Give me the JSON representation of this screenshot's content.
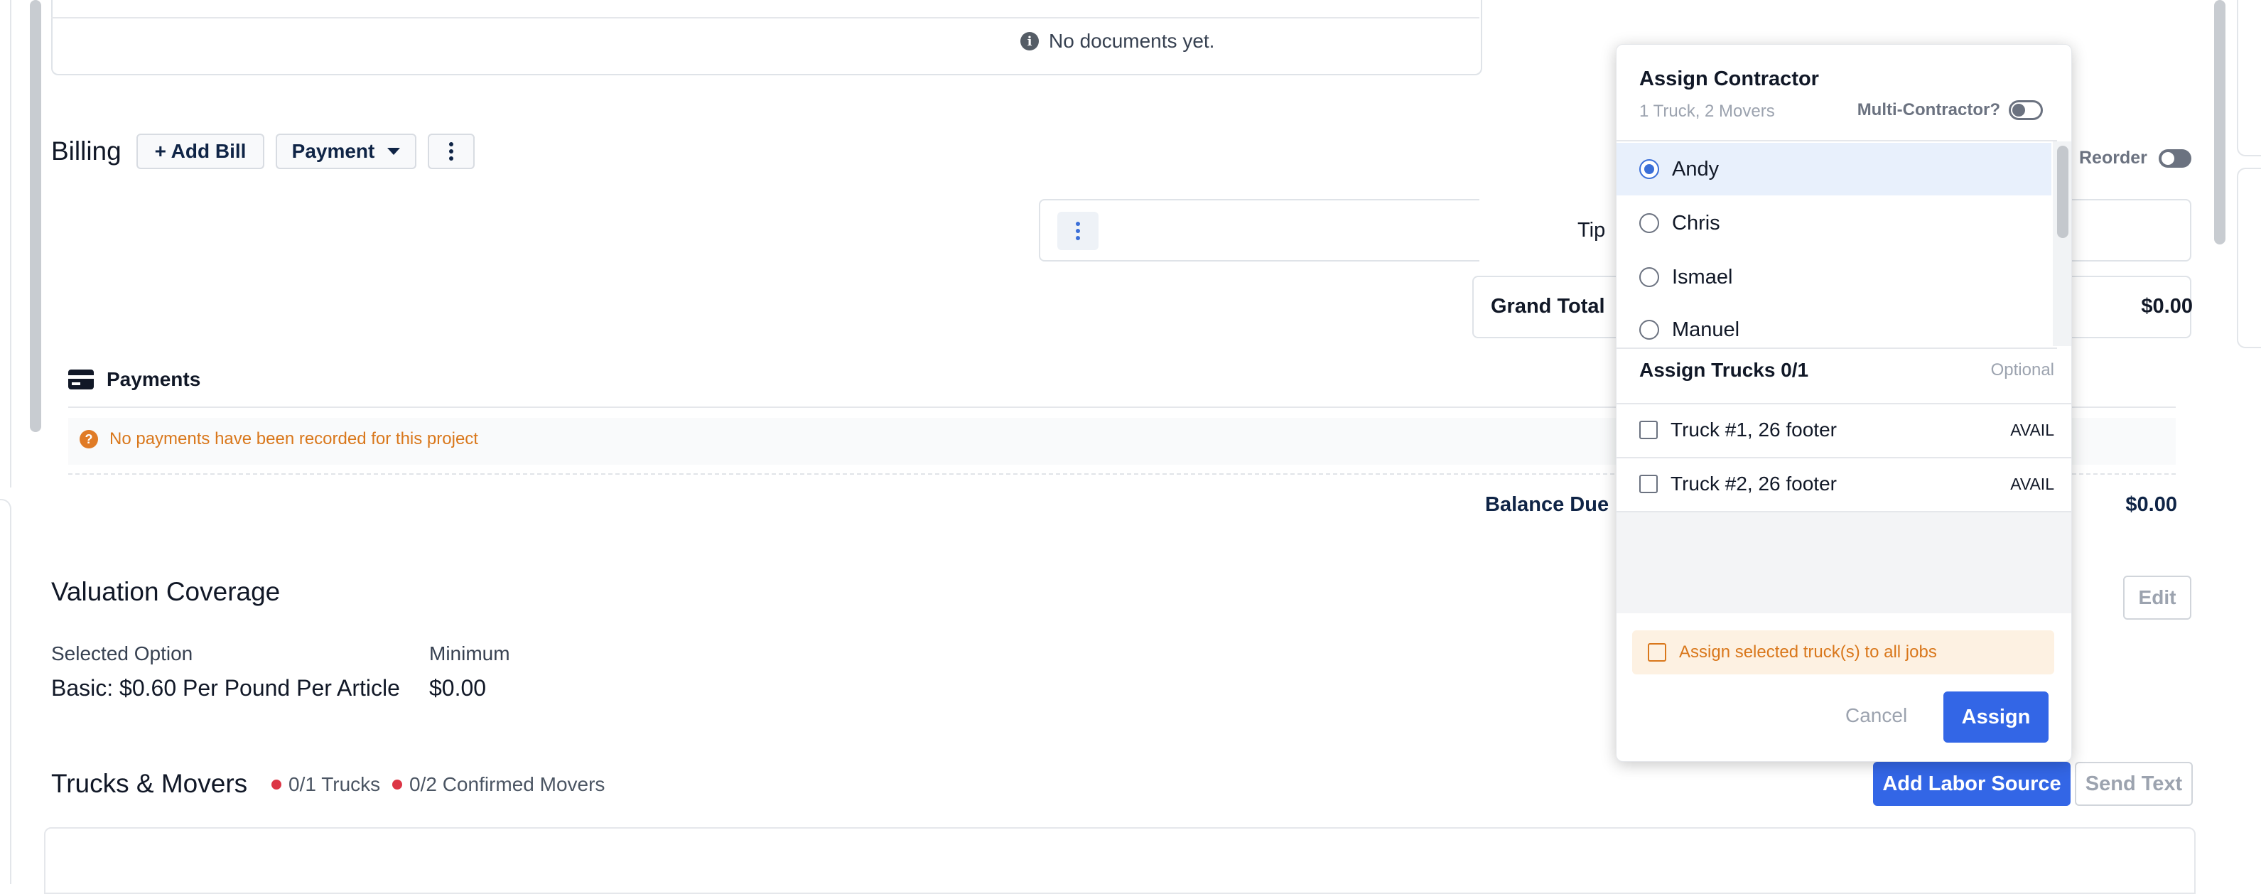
{
  "documents": {
    "empty_message": "No documents yet."
  },
  "billing": {
    "title": "Billing",
    "add_bill_label": "+ Add Bill",
    "payment_label": "Payment",
    "tip_label": "Tip",
    "grand_total_label": "Grand Total",
    "grand_total_value": "$0.00",
    "reorder_label": "Reorder"
  },
  "payments": {
    "title": "Payments",
    "empty_message": "No payments have been recorded for this project",
    "balance_due_label": "Balance Due",
    "balance_due_value": "$0.00"
  },
  "valuation": {
    "title": "Valuation Coverage",
    "edit_label": "Edit",
    "selected_option_label": "Selected Option",
    "selected_option_value": "Basic: $0.60 Per Pound Per Article",
    "minimum_label": "Minimum",
    "minimum_value": "$0.00"
  },
  "trucks_movers": {
    "title": "Trucks & Movers",
    "trucks_badge": "0/1 Trucks",
    "movers_badge": "0/2 Confirmed Movers",
    "add_labor_label": "Add Labor Source",
    "send_text_label": "Send Text"
  },
  "assign_popover": {
    "title": "Assign Contractor",
    "subtitle": "1 Truck, 2 Movers",
    "multi_label": "Multi-Contractor?",
    "contractors": [
      {
        "name": "Andy",
        "selected": true
      },
      {
        "name": "Chris",
        "selected": false
      },
      {
        "name": "Ismael",
        "selected": false
      },
      {
        "name": "Manuel",
        "selected": false
      }
    ],
    "trucks_title": "Assign Trucks 0/1",
    "trucks_optional": "Optional",
    "trucks": [
      {
        "name": "Truck #1, 26 footer",
        "status": "AVAIL"
      },
      {
        "name": "Truck #2, 26 footer",
        "status": "AVAIL"
      }
    ],
    "assign_all_label": "Assign selected truck(s) to all jobs",
    "cancel_label": "Cancel",
    "assign_label": "Assign"
  },
  "colors": {
    "primary": "#3366e6",
    "navy": "#0f2446",
    "warning": "#d9771b",
    "danger": "#dc3545",
    "selected_row": "#e8f0fc"
  },
  "icons": [
    "info-icon",
    "ellipsis-vertical-icon",
    "caret-down-icon",
    "credit-card-icon",
    "question-icon",
    "status-dot-icon"
  ]
}
